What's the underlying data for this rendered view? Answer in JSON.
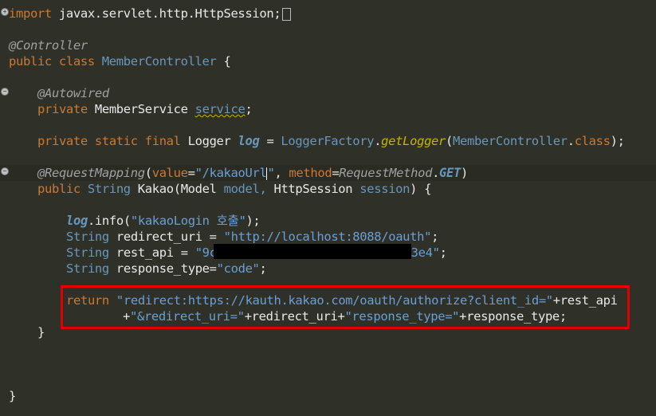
{
  "lines": {
    "l1": {
      "kw": "import",
      "text": " javax.servlet.http.HttpSession;"
    },
    "l2": {
      "ann": "@Controller"
    },
    "l3": {
      "kw1": "public",
      "kw2": "class",
      "name": "MemberController",
      "rest": " {"
    },
    "l4": {
      "ann": "@Autowired"
    },
    "l5": {
      "kw": "private",
      "type": "MemberService",
      "field": "service",
      "rest": ";"
    },
    "l6": {
      "kw": "private static final",
      "type": "Logger",
      "field": "log",
      "eq": " = ",
      "factory": "LoggerFactory",
      "dot": ".",
      "method": "getLogger",
      "open": "(",
      "cls": "MemberController",
      "dot2": ".",
      "classkw": "class",
      "close": ");"
    },
    "l7": {
      "ann": "@RequestMapping",
      "open": "(",
      "attr1": "value",
      "eq1": "=",
      "str1": "\"/kakaoUrl",
      "str1end": "\"",
      "comma": ", ",
      "attr2": "method",
      "eq2": "=",
      "enumtype": "RequestMethod",
      "dot": ".",
      "enumval": "GET",
      "close": ")"
    },
    "l8": {
      "kw": "public",
      "type": "String",
      "name": "Kakao",
      "params": "(Model model, HttpSession session) {",
      "p_open": "(",
      "p_type1": "Model",
      "p_name1": " model, ",
      "p_type2": "HttpSession",
      "p_name2": " session",
      "p_close": ") {"
    },
    "l9": {
      "field": "log",
      "call": ".info(",
      "str": "\"kakaoLogin 호출\"",
      "close": ");"
    },
    "l10": {
      "type": "String",
      "name": " redirect_uri = ",
      "str": "\"http://localhost:8088/oauth\"",
      "close": ";"
    },
    "l11": {
      "type": "String",
      "name": " rest_api = ",
      "str_start": "\"9c",
      "str_end": "3e4\"",
      "close": ";"
    },
    "l12": {
      "type": "String",
      "name": " response_type=",
      "str": "\"code\"",
      "close": ";"
    },
    "l13": {
      "kw": "return",
      "str": "\"redirect:https://kauth.kakao.com/oauth/authorize?client_id=\"",
      "rest": "+rest_api"
    },
    "l14": {
      "plus": "+",
      "str1": "\"&redirect_uri=\"",
      "mid": "+redirect_uri+",
      "str2": "\"response_type=\"",
      "rest": "+response_type;"
    },
    "l15": {
      "text": "}"
    },
    "l16": {
      "text": "}"
    }
  },
  "colors": {
    "background": "#2f3129",
    "keyword": "#cc7832",
    "type": "#6897bb",
    "string": "#6a9fd4",
    "highlight_box": "#e00000"
  },
  "icons": {
    "fold_marker": "plus-circle-icon"
  }
}
